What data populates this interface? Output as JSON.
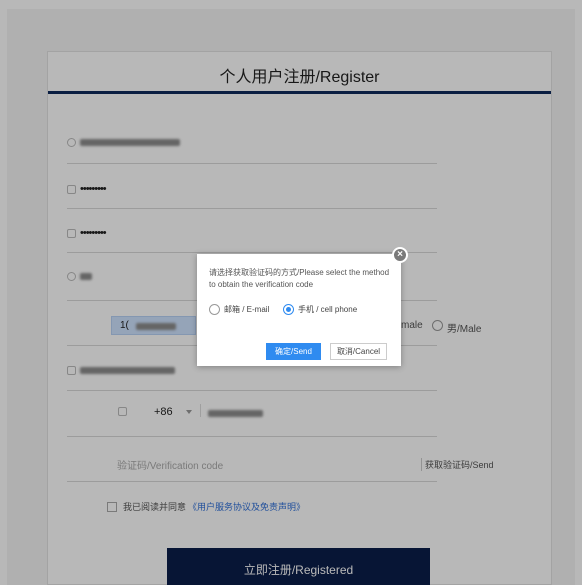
{
  "form": {
    "title": "个人用户注册/Register",
    "password_mask": "•••••••••",
    "confirm_mask": "•••••••••",
    "gender_female": "male",
    "gender_male": "男/Male",
    "id_prefix": "1(",
    "phone_prefix": "+86",
    "code_placeholder": "验证码/Verification code",
    "send_code": "获取验证码/Send",
    "agree_text": "我已阅读并同意",
    "agree_link": "《用户服务协议及免责声明》",
    "register_button": "立即注册/Registered"
  },
  "modal": {
    "message": "请选择获取验证码的方式/Please select the method to obtain the verification code",
    "option_email": "邮箱 / E-mail",
    "option_phone": "手机 / cell phone",
    "selected": "phone",
    "confirm": "确定/Send",
    "cancel": "取消/Cancel",
    "close": "×"
  },
  "colors": {
    "primary": "#0b1e4a",
    "accent": "#2f8bf0",
    "header_rule": "#0e2a5c"
  }
}
